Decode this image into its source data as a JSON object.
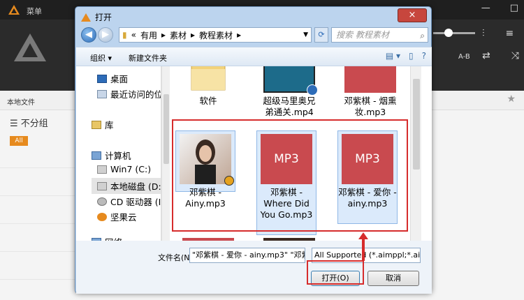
{
  "background_app": {
    "menu_label": "菜单",
    "ab_label": "A-B",
    "tab_label": "本地文件",
    "group_label": "不分组",
    "all_badge": "All",
    "accent_color": "#e68a1e"
  },
  "dialog": {
    "title": "打开",
    "close_icon": "×",
    "path_segments": [
      "«",
      "有用",
      "▸",
      "素材",
      "▸",
      "教程素材",
      "▸"
    ],
    "search_placeholder": "搜索 教程素材",
    "toolbar": {
      "organize_label": "组织 ▾",
      "new_folder_label": "新建文件夹"
    },
    "nav_items": [
      {
        "label": "桌面",
        "icon": "desktop-icon"
      },
      {
        "label": "最近访问的位",
        "icon": "recent-places-icon"
      },
      {
        "label": "库",
        "icon": "library-icon"
      },
      {
        "label": "计算机",
        "icon": "computer-icon"
      },
      {
        "label": "Win7 (C:)",
        "icon": "drive-icon"
      },
      {
        "label": "本地磁盘 (D:",
        "icon": "drive-icon"
      },
      {
        "label": "CD 驱动器 (I",
        "icon": "cd-drive-icon"
      },
      {
        "label": "坚果云",
        "icon": "nutstore-icon"
      },
      {
        "label": "网络",
        "icon": "network-icon"
      }
    ],
    "files": [
      {
        "name": "软件",
        "type": "folder"
      },
      {
        "name": "超级马里奥兄弟通关.mp4",
        "type": "video"
      },
      {
        "name": "邓紫棋 - 烟熏妆.mp3",
        "type": "mp3"
      },
      {
        "name": "邓紫棋 - Ainy.mp3",
        "type": "photo"
      },
      {
        "name": "邓紫棋 - Where Did You Go.mp3",
        "type": "mp3"
      },
      {
        "name": "邓紫棋 - 爱你 - ainy.mp3",
        "type": "mp3"
      }
    ],
    "mp3_label": "MP3",
    "filename_label": "文件名(N):",
    "filename_value": "\"邓紫棋 - 爱你 - ainy.mp3\" \"邓紫",
    "filter_value": "All Supported (*.aimppl;*.ain",
    "open_button": "打开(O)",
    "cancel_button": "取消"
  }
}
